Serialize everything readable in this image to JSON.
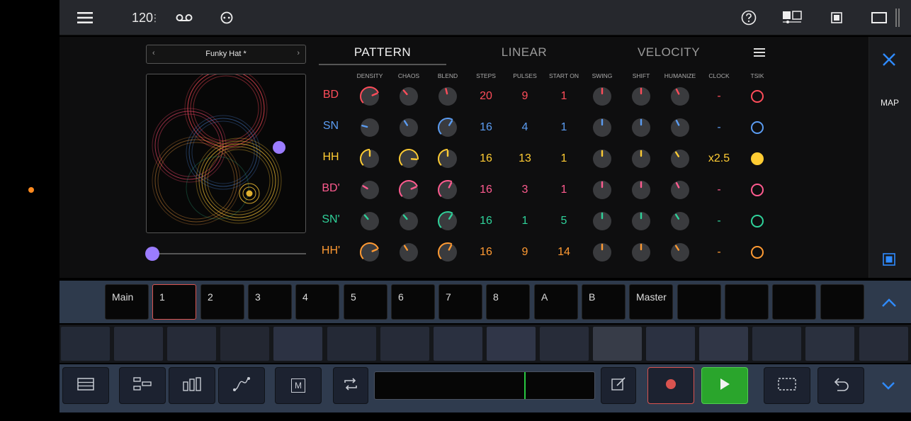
{
  "colors": {
    "bd": "#ff4d5a",
    "sn": "#5b9cf2",
    "hh": "#ffcc33",
    "bd2": "#ff5b8f",
    "sn2": "#2fd29a",
    "hh2": "#ff9a33",
    "accent_blue": "#2f8bff",
    "slider_purple": "#9b7cff",
    "record_red": "#d9534f",
    "play_green": "#2aa52c",
    "playhead_green": "#28c840"
  },
  "topbar": {
    "tempo": "120",
    "tempo_more": "⋮",
    "icons": [
      "menu-icon",
      "tape-icon",
      "link-icon",
      "help-icon",
      "layout-icon",
      "window-icon",
      "window-wide-icon",
      "grip-icon"
    ]
  },
  "preset": {
    "name": "Funky Hat *",
    "prev": "‹",
    "next": "›"
  },
  "slider": {
    "value": 0.0
  },
  "tabs": {
    "pattern": "PATTERN",
    "linear": "LINEAR",
    "velocity": "VELOCITY",
    "active": "pattern"
  },
  "columns": {
    "density": "DENSITY",
    "chaos": "CHAOS",
    "blend": "BLEND",
    "steps": "STEPS",
    "pulses": "PULSES",
    "start_on": "START ON",
    "swing": "SWING",
    "shift": "SHIFT",
    "humanize": "HUMANIZE",
    "clock": "CLOCK",
    "tsik": "TSIK"
  },
  "tracks": [
    {
      "label": "BD",
      "color": "#ff4d5a",
      "steps": "20",
      "pulses": "9",
      "start_on": "1",
      "clock": "-",
      "tsik_filled": false,
      "knobs": {
        "density": 0.75,
        "chaos": 0.35,
        "blend": 0.45,
        "swing": 0.5,
        "shift": 0.5,
        "humanize": 0.4
      }
    },
    {
      "label": "SN",
      "color": "#5b9cf2",
      "steps": "16",
      "pulses": "4",
      "start_on": "1",
      "clock": "-",
      "tsik_filled": false,
      "knobs": {
        "density": 0.22,
        "chaos": 0.38,
        "blend": 0.62,
        "swing": 0.5,
        "shift": 0.5,
        "humanize": 0.4
      }
    },
    {
      "label": "HH",
      "color": "#ffcc33",
      "steps": "16",
      "pulses": "13",
      "start_on": "1",
      "clock": "x2.5",
      "tsik_filled": true,
      "knobs": {
        "density": 0.5,
        "chaos": 0.85,
        "blend": 0.5,
        "swing": 0.5,
        "shift": 0.5,
        "humanize": 0.38
      }
    },
    {
      "label": "BD'",
      "color": "#ff5b8f",
      "steps": "16",
      "pulses": "3",
      "start_on": "1",
      "clock": "-",
      "tsik_filled": false,
      "knobs": {
        "density": 0.28,
        "chaos": 0.75,
        "blend": 0.6,
        "swing": 0.5,
        "shift": 0.5,
        "humanize": 0.4
      }
    },
    {
      "label": "SN'",
      "color": "#2fd29a",
      "steps": "16",
      "pulses": "1",
      "start_on": "5",
      "clock": "-",
      "tsik_filled": false,
      "knobs": {
        "density": 0.35,
        "chaos": 0.35,
        "blend": 0.62,
        "swing": 0.5,
        "shift": 0.5,
        "humanize": 0.38
      }
    },
    {
      "label": "HH'",
      "color": "#ff9a33",
      "steps": "16",
      "pulses": "9",
      "start_on": "14",
      "clock": "-",
      "tsik_filled": false,
      "knobs": {
        "density": 0.75,
        "chaos": 0.38,
        "blend": 0.6,
        "swing": 0.5,
        "shift": 0.5,
        "humanize": 0.38
      }
    }
  ],
  "side": {
    "map_label": "MAP"
  },
  "scenes": {
    "items": [
      "Main",
      "1",
      "2",
      "3",
      "4",
      "5",
      "6",
      "7",
      "8",
      "A",
      "B",
      "Master",
      "",
      "",
      "",
      ""
    ],
    "active_index": 1
  },
  "pads": {
    "count": 16,
    "shades": [
      "#242a37",
      "#262b38",
      "#262b38",
      "#232732",
      "#2c3243",
      "#242936",
      "#262b38",
      "#2a3040",
      "#303648",
      "#272c39",
      "#373c48",
      "#2b3141",
      "#303646",
      "#262c39",
      "#2a303e",
      "#272c39"
    ]
  },
  "bottombar": {
    "icons": [
      "list-icon",
      "sequencer-icon",
      "mixer-icon",
      "curve-icon",
      "macro-icon",
      "loop-icon",
      "edit-icon",
      "record-icon",
      "play-icon",
      "select-icon",
      "undo-icon",
      "chevron-down-icon"
    ],
    "macro_letter": "M"
  }
}
